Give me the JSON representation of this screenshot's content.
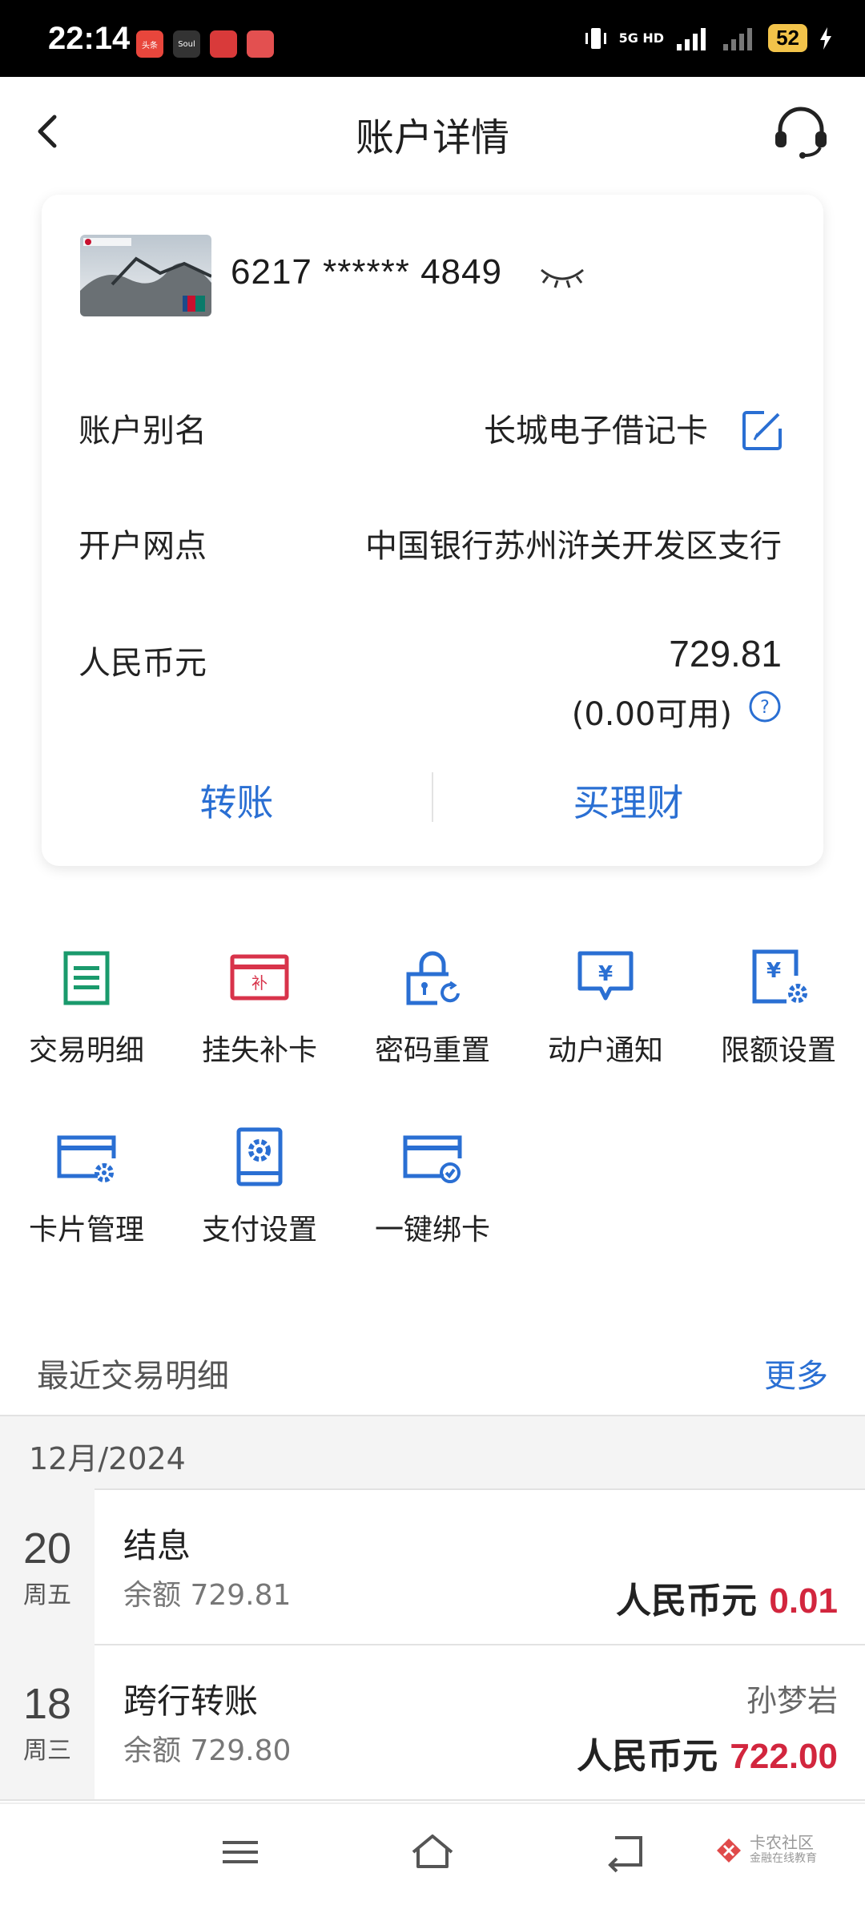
{
  "status_bar": {
    "time": "22:14",
    "apps": [
      {
        "name": "toutiao-app-icon",
        "label": "头条",
        "color": "#e8463c"
      },
      {
        "name": "soul-app-icon",
        "label": "Soul",
        "color": "#222222"
      },
      {
        "name": "app3-icon",
        "label": "",
        "color": "#d93a3a"
      },
      {
        "name": "app4-icon",
        "label": "",
        "color": "#e35050"
      }
    ],
    "network": "5G HD",
    "battery": "52"
  },
  "header": {
    "title": "账户详情",
    "back_icon": "back-arrow-icon",
    "service_icon": "headset-icon"
  },
  "account": {
    "card_number": "6217 ****** 4849",
    "alias_label": "账户别名",
    "alias_value": "长城电子借记卡",
    "branch_label": "开户网点",
    "branch_value": "中国银行苏州浒关开发区支行",
    "currency_label": "人民币元",
    "balance": "729.81",
    "available": "(0.00可用)"
  },
  "actions": {
    "transfer": "转账",
    "buy_finance": "买理财"
  },
  "functions": [
    {
      "label": "交易明细",
      "icon": "transaction-list-icon",
      "color": "#1a9a6c"
    },
    {
      "label": "挂失补卡",
      "icon": "report-loss-card-icon",
      "color": "#d8334a"
    },
    {
      "label": "密码重置",
      "icon": "password-reset-icon",
      "color": "#2a6fd3"
    },
    {
      "label": "动户通知",
      "icon": "account-notice-icon",
      "color": "#2a6fd3"
    },
    {
      "label": "限额设置",
      "icon": "limit-setting-icon",
      "color": "#2a6fd3"
    },
    {
      "label": "卡片管理",
      "icon": "card-manage-icon",
      "color": "#2a6fd3"
    },
    {
      "label": "支付设置",
      "icon": "payment-setting-icon",
      "color": "#2a6fd3"
    },
    {
      "label": "一键绑卡",
      "icon": "bind-card-icon",
      "color": "#2a6fd3"
    }
  ],
  "recent": {
    "title": "最近交易明细",
    "more": "更多",
    "month": "12月/2024",
    "transactions": [
      {
        "day": "20",
        "weekday": "周五",
        "name": "结息",
        "balance": "余额 729.81",
        "party": "",
        "currency": "人民币元",
        "amount": "0.01"
      },
      {
        "day": "18",
        "weekday": "周三",
        "name": "跨行转账",
        "balance": "余额 729.80",
        "party": "孙梦岩",
        "currency": "人民币元",
        "amount": "722.00"
      }
    ]
  },
  "watermark": {
    "title": "卡农社区",
    "subtitle": "金融在线教育"
  }
}
